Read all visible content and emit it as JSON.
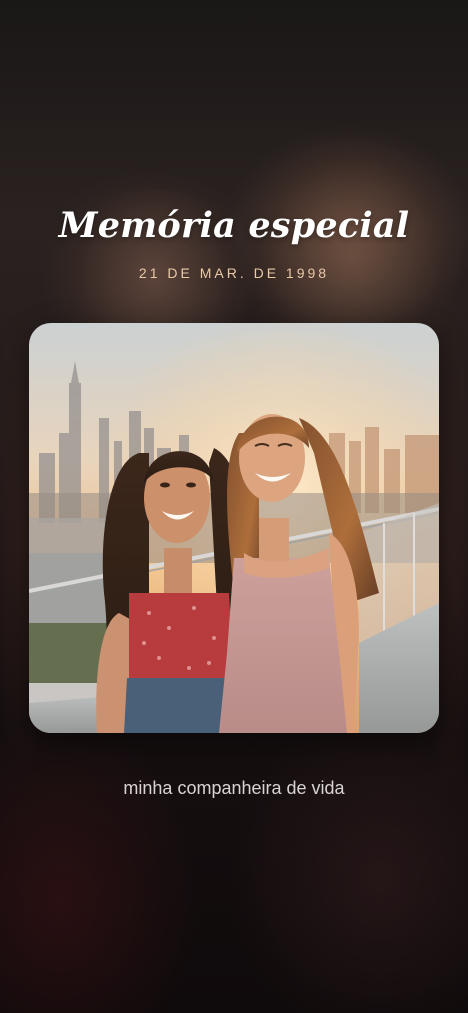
{
  "memory": {
    "title": "Memória especial",
    "date": "21 DE MAR. DE 1998",
    "caption": "minha companheira de vida",
    "photo_subject": "two-friends-rooftop-sunset-photo"
  },
  "colors": {
    "date_accent": "#e9c9a6",
    "title": "#ffffff",
    "caption": "#d9d4d2",
    "background": "#120d0e"
  }
}
